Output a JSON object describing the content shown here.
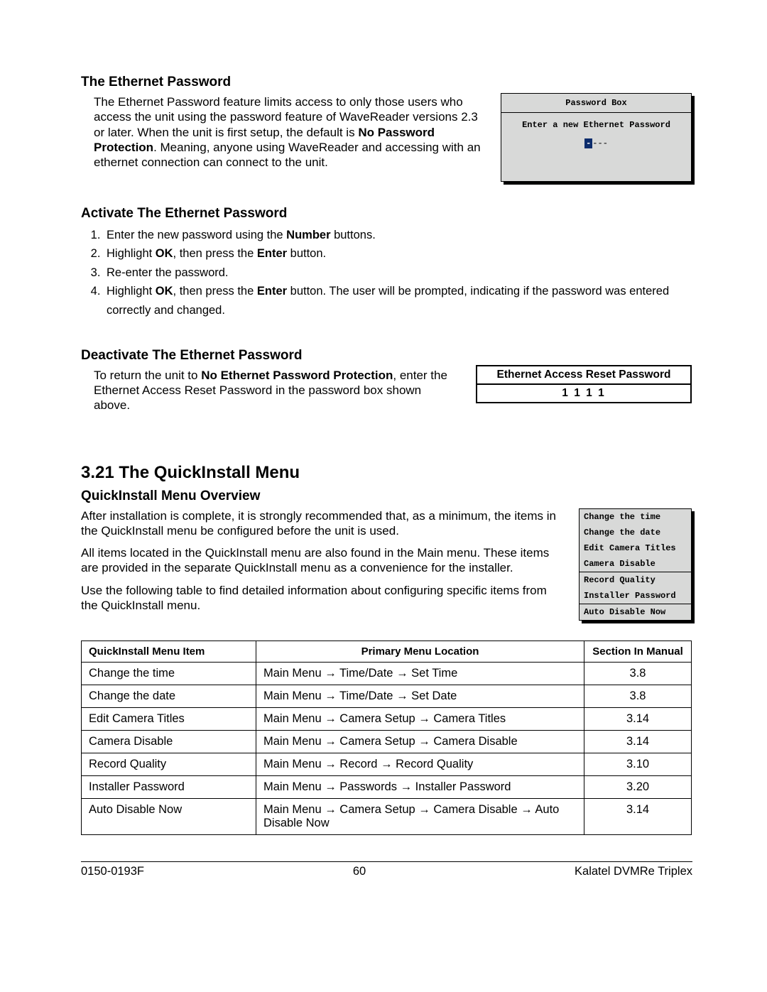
{
  "sections": {
    "eth_title": "The Ethernet Password",
    "eth_p1_a": "The Ethernet Password feature limits access to only those users who access the unit using the password feature of WaveReader versions 2.3 or later.  When the unit is first setup, the default is ",
    "eth_p1_b": "No Password Protection",
    "eth_p1_c": ".  Meaning, anyone using WaveReader and accessing with an ethernet connection can connect to the unit.",
    "activate_title": "Activate The Ethernet Password",
    "steps": [
      {
        "a": "Enter the new password using the ",
        "b": "Number",
        "c": " buttons."
      },
      {
        "a": "Highlight ",
        "b": "OK",
        "c": ", then press the ",
        "d": "Enter",
        "e": " button."
      },
      {
        "a": "Re-enter the password."
      },
      {
        "a": "Highlight ",
        "b": "OK",
        "c": ", then press the ",
        "d": "Enter",
        "e": " button.  The user will be prompted, indicating if the password was entered correctly and changed."
      }
    ],
    "deactivate_title": "Deactivate The Ethernet Password",
    "deact_a": "To return the unit to ",
    "deact_b": "No Ethernet Password Protection",
    "deact_c": ", enter the Ethernet Access Reset Password in the password box shown above.",
    "qi_heading": "3.21 The QuickInstall Menu",
    "qi_overview_title": "QuickInstall Menu Overview",
    "qi_p1": "After installation is complete, it is strongly recommended that, as a minimum, the items in the QuickInstall menu be configured before the unit is used.",
    "qi_p2": "All items located in the QuickInstall menu are also found in the Main menu.  These items are provided in the separate QuickInstall menu as a convenience for the installer.",
    "qi_p3": "Use the following table to find detailed information about configuring specific items from the QuickInstall menu."
  },
  "password_box": {
    "title": "Password Box",
    "subtitle": "Enter a new Ethernet Password",
    "cursor": "-",
    "rest": "---"
  },
  "reset_box": {
    "title": "Ethernet Access Reset Password",
    "value": "1 1 1 1"
  },
  "qi_menu": [
    "Change the time",
    "Change the date",
    "Edit Camera Titles",
    "Camera Disable",
    "Record Quality",
    "Installer Password",
    "Auto Disable Now"
  ],
  "qi_table": {
    "headers": [
      "QuickInstall Menu Item",
      "Primary Menu Location",
      "Section In Manual"
    ],
    "rows": [
      {
        "item": "Change the time",
        "path": [
          "Main Menu",
          "Time/Date",
          "Set Time"
        ],
        "sec": "3.8"
      },
      {
        "item": "Change the date",
        "path": [
          "Main Menu",
          "Time/Date",
          "Set Date"
        ],
        "sec": "3.8"
      },
      {
        "item": "Edit Camera Titles",
        "path": [
          "Main Menu",
          "Camera Setup",
          "Camera Titles"
        ],
        "sec": "3.14"
      },
      {
        "item": "Camera Disable",
        "path": [
          "Main Menu",
          "Camera Setup",
          "Camera Disable"
        ],
        "sec": "3.14"
      },
      {
        "item": "Record Quality",
        "path": [
          "Main Menu",
          "Record",
          "Record Quality"
        ],
        "sec": "3.10"
      },
      {
        "item": "Installer Password",
        "path": [
          "Main Menu",
          "Passwords",
          "Installer Password"
        ],
        "sec": "3.20"
      },
      {
        "item": "Auto Disable Now",
        "path": [
          "Main Menu",
          "Camera Setup",
          "Camera Disable",
          "Auto Disable Now"
        ],
        "sec": "3.14"
      }
    ]
  },
  "footer": {
    "left": "0150-0193F",
    "center": "60",
    "right": "Kalatel DVMRe Triplex"
  }
}
